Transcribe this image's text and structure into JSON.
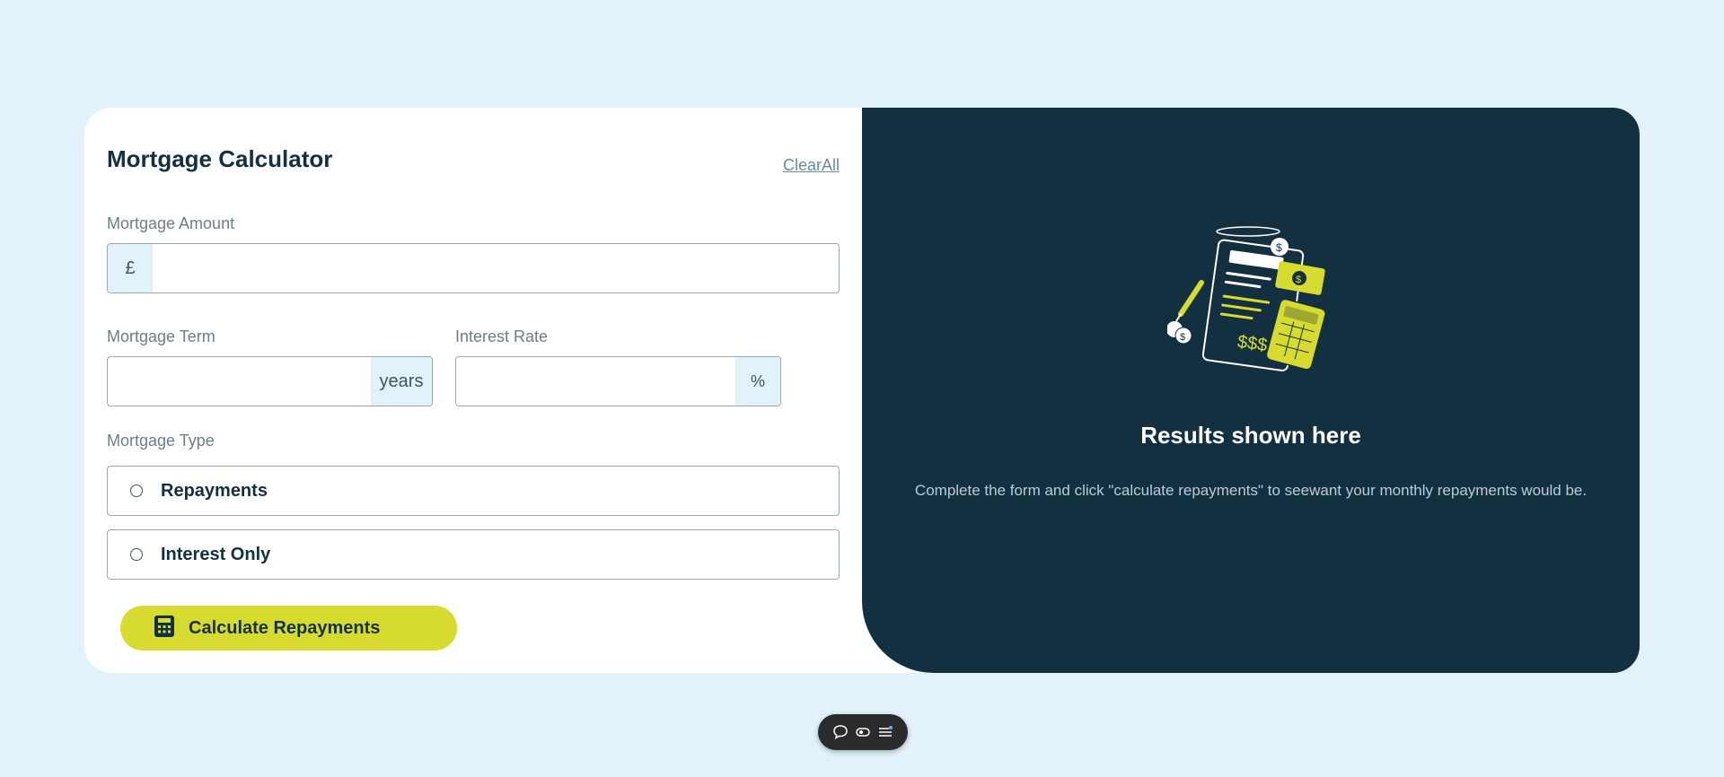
{
  "form": {
    "title": "Mortgage Calculator",
    "clear_label": "ClearAll",
    "amount": {
      "label": "Mortgage Amount",
      "prefix": "£",
      "value": ""
    },
    "term": {
      "label": "Mortgage Term",
      "suffix": "years",
      "value": ""
    },
    "rate": {
      "label": "Interest Rate",
      "suffix": "%",
      "value": ""
    },
    "type": {
      "label": "Mortgage Type",
      "options": [
        {
          "label": "Repayments",
          "selected": false
        },
        {
          "label": "Interest Only",
          "selected": false
        }
      ]
    },
    "submit_label": "Calculate Repayments"
  },
  "results": {
    "title": "Results shown here",
    "description": "Complete the form and click \"calculate repayments\" to seewant your monthly repayments would be."
  },
  "colors": {
    "page_bg": "#e1f2fb",
    "dark": "#133041",
    "accent": "#d8db2f",
    "muted": "#6b7d88"
  },
  "toolbar": {
    "icons": [
      "comment-icon",
      "toggle-icon",
      "menu-icon"
    ]
  }
}
